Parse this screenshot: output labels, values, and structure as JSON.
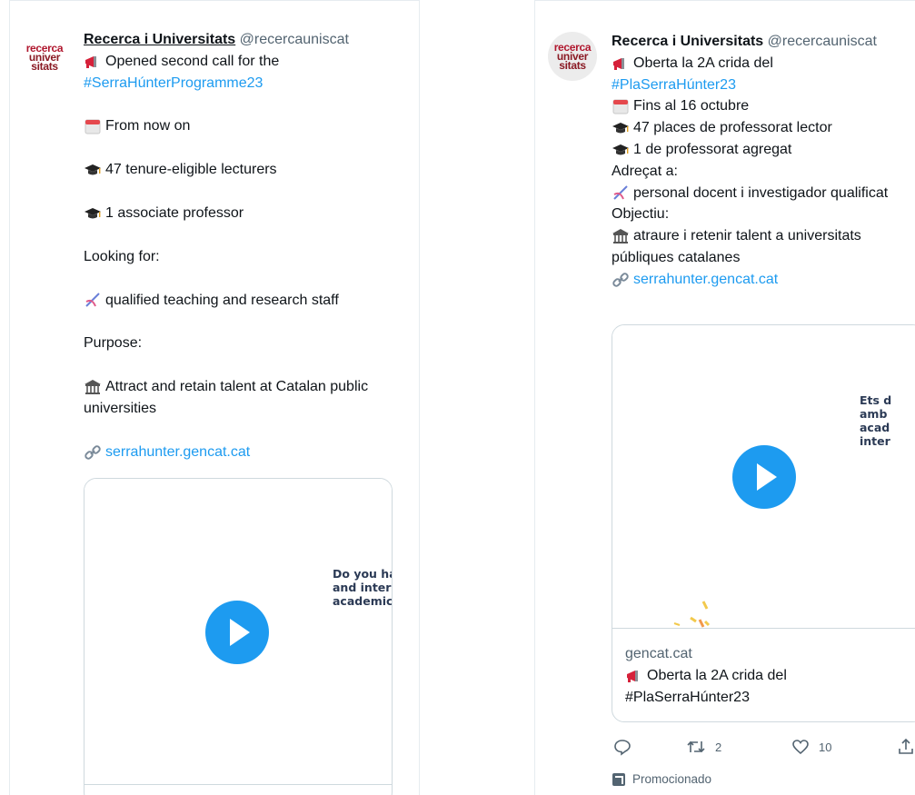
{
  "account": {
    "name": "Recerca i Universitats",
    "handle": "@recercauniscat",
    "avatar_lines": [
      "recerca",
      "univer",
      "sitats"
    ]
  },
  "left_tweet": {
    "line1": "Opened second call for the",
    "hashtag": "#SerraHúnterProgramme23",
    "from_now": "From now on",
    "lecturers": "47 tenure-eligible lecturers",
    "associate": "1 associate professor",
    "looking_for": "Looking for:",
    "staff": "qualified teaching and research staff",
    "purpose": "Purpose:",
    "attract": "Attract and retain talent at Catalan public universities",
    "url": "serrahunter.gencat.cat",
    "media_text": "Do you ha\nand inter\nacademic"
  },
  "right_tweet": {
    "line1": "Oberta la 2A crida del",
    "hashtag": "#PlaSerraHúnter23",
    "deadline": "Fins al 16 octubre",
    "lecturers": "47 places de professorat lector",
    "associate": "1 de professorat agregat",
    "adressat": "Adreçat a:",
    "staff": "personal docent i investigador qualificat",
    "objectiu": "Objectiu:",
    "attract": "atraure i retenir talent a universitats públiques catalanes",
    "url": "serrahunter.gencat.cat",
    "media_text": "Ets d\namb \nacad\ninter",
    "card_domain": "gencat.cat",
    "card_title_line1": "Oberta la 2A crida del",
    "card_title_line2": "#PlaSerraHúnter23",
    "retweets": "2",
    "likes": "10",
    "promoted": "Promocionado"
  }
}
